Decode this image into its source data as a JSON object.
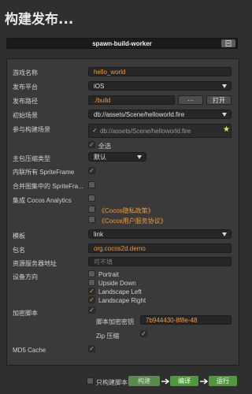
{
  "window": {
    "title": "构建发布..."
  },
  "name_bar": {
    "value": "spawn-build-worker",
    "icon": "file-icon"
  },
  "form": {
    "game_name": {
      "label": "游戏名称",
      "value": "hello_world"
    },
    "platform": {
      "label": "发布平台",
      "value": "iOS"
    },
    "build_path": {
      "label": "发布路径",
      "value": "./build",
      "browse_label": "···",
      "open_label": "打开"
    },
    "start_scene": {
      "label": "初始场景",
      "value": "db://assets/Scene/helloworld.fire"
    },
    "scenes": {
      "label": "参与构建场景",
      "item": "db://assets/Scene/helloworld.fire",
      "select_all_label": "全选"
    },
    "compression": {
      "label": "主包压缩类型",
      "value": "默认"
    },
    "inline_sprite": {
      "label": "内联所有 SpriteFrame"
    },
    "merge_sprite": {
      "label": "合并图集中的 SpriteFra..."
    },
    "analytics": {
      "label": "集成 Cocos Analytics",
      "privacy_link": "《Cocos隐私政策》",
      "terms_link": "《Cocos用户服务协议》"
    },
    "template": {
      "label": "模板",
      "value": "link"
    },
    "package": {
      "label": "包名",
      "value": "org.cocos2d.demo"
    },
    "server": {
      "label": "资源服务器地址",
      "placeholder": "可不填"
    },
    "orientation": {
      "label": "设备方向",
      "options": [
        {
          "label": "Portrait",
          "checked": false
        },
        {
          "label": "Upside Down",
          "checked": false
        },
        {
          "label": "Landscape Left",
          "checked": true
        },
        {
          "label": "Landscape Right",
          "checked": true
        }
      ]
    },
    "encrypt": {
      "label": "加密脚本",
      "key_label": "脚本加密密钥",
      "key_value": "7b944430-8f8e-48",
      "zip_label": "Zip 压缩"
    },
    "md5": {
      "label": "MD5 Cache"
    }
  },
  "footer": {
    "build_only_label": "只构建脚本",
    "build_label": "构建",
    "compile_label": "编译",
    "run_label": "运行"
  },
  "colors": {
    "accent": "#f29a34",
    "green": "#4e9a3a",
    "green_dim": "#5b8a4e"
  }
}
